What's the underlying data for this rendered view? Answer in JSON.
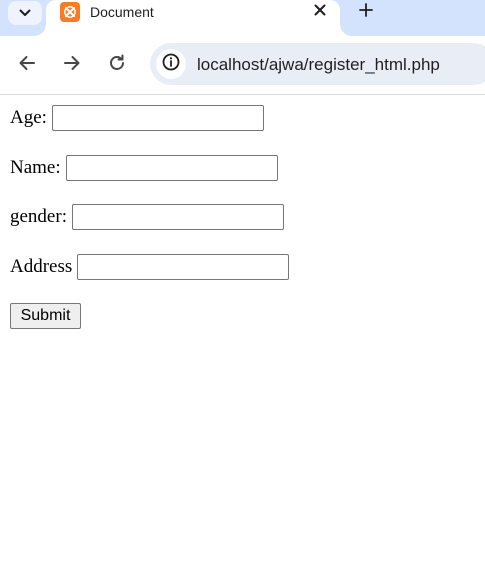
{
  "browser": {
    "tab": {
      "title": "Document",
      "favicon": "xampp-icon",
      "favicon_color": "#fb7a24"
    },
    "address_bar": {
      "url": "localhost/ajwa/register_html.php"
    },
    "colors": {
      "tabstrip_bg": "#d3e3fd",
      "omnibox_bg": "#e9eef6"
    }
  },
  "form": {
    "fields": [
      {
        "label": "Age:",
        "value": "",
        "placeholder": ""
      },
      {
        "label": "Name:",
        "value": "",
        "placeholder": ""
      },
      {
        "label": "gender:",
        "value": "",
        "placeholder": ""
      },
      {
        "label": "Address",
        "value": "",
        "placeholder": ""
      }
    ],
    "submit_label": "Submit"
  }
}
